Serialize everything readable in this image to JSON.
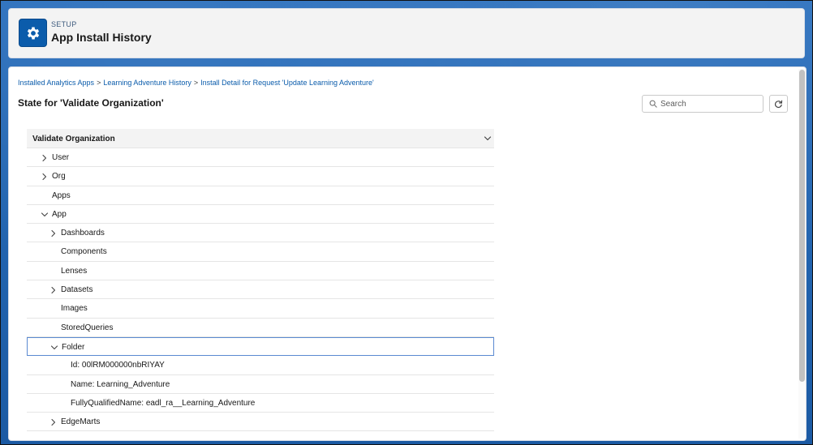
{
  "header": {
    "eyebrow": "SETUP",
    "title": "App Install History",
    "icon": "gear-icon"
  },
  "breadcrumb": [
    "Installed Analytics Apps",
    "Learning Adventure History",
    "Install Detail for Request 'Update Learning Adventure'"
  ],
  "breadcrumb_separator": ">",
  "state_title": "State for 'Validate Organization'",
  "search": {
    "placeholder": "Search",
    "value": ""
  },
  "tree": {
    "header": "Validate Organization",
    "rows": [
      {
        "label": "User",
        "level": 1,
        "toggle": "collapsed"
      },
      {
        "label": "Org",
        "level": 1,
        "toggle": "collapsed"
      },
      {
        "label": "Apps",
        "level": 1,
        "toggle": "none"
      },
      {
        "label": "App",
        "level": 1,
        "toggle": "expanded"
      },
      {
        "label": "Dashboards",
        "level": 2,
        "toggle": "collapsed"
      },
      {
        "label": "Components",
        "level": 2,
        "toggle": "none"
      },
      {
        "label": "Lenses",
        "level": 2,
        "toggle": "none"
      },
      {
        "label": "Datasets",
        "level": 2,
        "toggle": "collapsed"
      },
      {
        "label": "Images",
        "level": 2,
        "toggle": "none"
      },
      {
        "label": "StoredQueries",
        "level": 2,
        "toggle": "none"
      },
      {
        "label": "Folder",
        "level": 2,
        "toggle": "expanded",
        "selected": true
      },
      {
        "label": "Id: 00lRM000000nbRIYAY",
        "level": 3,
        "toggle": "none"
      },
      {
        "label": "Name: Learning_Adventure",
        "level": 3,
        "toggle": "none"
      },
      {
        "label": "FullyQualifiedName: eadl_ra__Learning_Adventure",
        "level": 3,
        "toggle": "none"
      },
      {
        "label": "EdgeMarts",
        "level": 2,
        "toggle": "collapsed"
      }
    ]
  },
  "colors": {
    "brand": "#0b5cab",
    "background": "#1f5fa8",
    "selected_border": "#5b8ad1"
  }
}
